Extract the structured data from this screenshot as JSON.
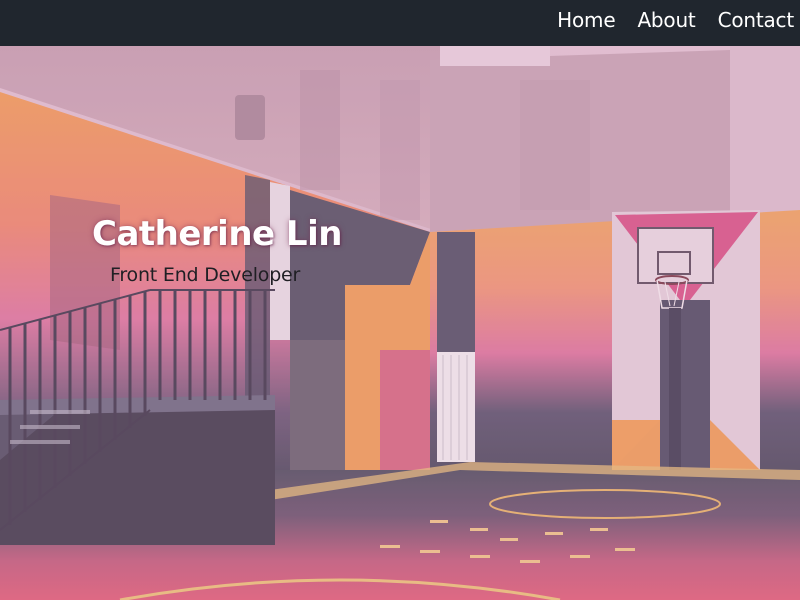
{
  "nav": {
    "items": [
      {
        "label": "Home"
      },
      {
        "label": "About"
      },
      {
        "label": "Contact"
      }
    ]
  },
  "hero": {
    "name": "Catherine Lin",
    "role": "Front End Developer",
    "background": "photo of a colorful outdoor basketball court with gradient painted walls",
    "colors": {
      "orange": "#f0a15c",
      "pink": "#e07aa0",
      "slate": "#545466",
      "navbar": "#20262e"
    }
  }
}
